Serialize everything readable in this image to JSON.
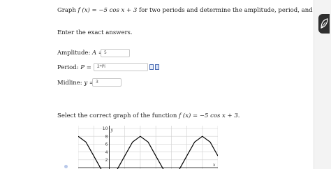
{
  "question": {
    "prefix": "Graph",
    "function": "f (x) = −5 cos x + 3",
    "suffix": "for two periods and determine the amplitude, period, and midline."
  },
  "instruction": "Enter the exact answers.",
  "fields": {
    "amplitude": {
      "label": "Amplitude:",
      "symbol": "A =",
      "value": "5"
    },
    "period": {
      "label": "Period:",
      "symbol": "P =",
      "value": "2*Pi"
    },
    "midline": {
      "label": "Midline:",
      "symbol": "y =",
      "value": "3"
    }
  },
  "graph_prompt": {
    "prefix": "Select the correct graph of the function",
    "function": "f (x) = −5 cos x + 3",
    "suffix": "."
  },
  "icons": {
    "edit_tool": "equation-editor-icon",
    "side_button": "leaf-icon"
  },
  "chart_data": {
    "type": "line",
    "title": "",
    "xlabel": "x",
    "ylabel": "y",
    "ylim": [
      0,
      10
    ],
    "y_ticks": [
      2,
      4,
      6,
      8,
      10
    ],
    "grid": true,
    "series": [
      {
        "x": [
          -3.14,
          -2.36,
          -1.57,
          -0.79,
          0,
          0.79,
          1.57,
          2.36,
          3.14,
          3.93,
          4.71,
          5.5,
          6.28,
          7.07,
          7.85,
          8.64,
          9.42,
          10.21,
          10.99
        ],
        "values": [
          8,
          6.54,
          3,
          -0.54,
          -2,
          -0.54,
          3,
          6.54,
          8,
          6.54,
          3,
          -0.54,
          -2,
          -0.54,
          3,
          6.54,
          8,
          6.54,
          3
        ]
      }
    ],
    "colors": {
      "line": "#000000",
      "grid": "#d0d0d0",
      "axis": "#000000"
    }
  }
}
